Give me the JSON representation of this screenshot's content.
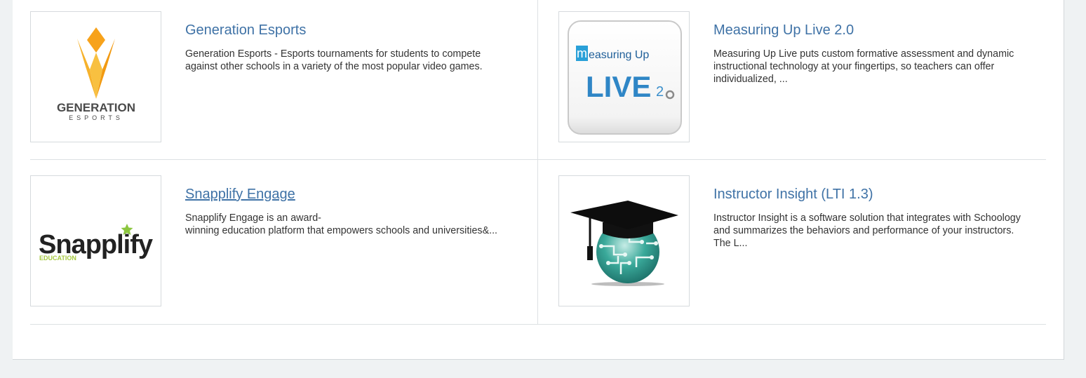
{
  "colors": {
    "page_background": "#eff2f3",
    "panel_background": "#ffffff",
    "link": "#3f72a6",
    "text": "#333333",
    "divider": "#dde1e3"
  },
  "apps": [
    {
      "title": "Generation Esports",
      "description_lines": [
        "Generation Esports - Esports tournaments for students to compete",
        "against other schools in a variety of the most popular video games."
      ],
      "logo": {
        "name": "generation-esports-logo",
        "wordmark": "GENERATION",
        "sub": "ESPORTS"
      }
    },
    {
      "title": "Measuring Up Live 2.0",
      "description_lines": [
        "Measuring Up Live puts custom formative assessment and dynamic",
        "instructional technology at your fingertips, so teachers can offer",
        "individualized, ..."
      ],
      "logo": {
        "name": "measuring-up-live-logo",
        "m": "m",
        "top": "easuring Up",
        "live": "LIVE",
        "version": "2.0"
      }
    },
    {
      "title": "Snapplify Engage",
      "description_lines": [
        "Snapplify Engage is an award-",
        "winning education platform that empowers schools and universities&..."
      ],
      "logo": {
        "name": "snapplify-logo",
        "wordmark": "Snapplify",
        "sub": "EDUCATION"
      }
    },
    {
      "title": "Instructor Insight (LTI 1.3)",
      "description_lines": [
        "Instructor Insight is a software solution that integrates with Schoology",
        "and summarizes the behaviors and performance of your instructors.",
        "The L..."
      ],
      "logo": {
        "name": "graduation-cap-globe-logo"
      }
    }
  ]
}
